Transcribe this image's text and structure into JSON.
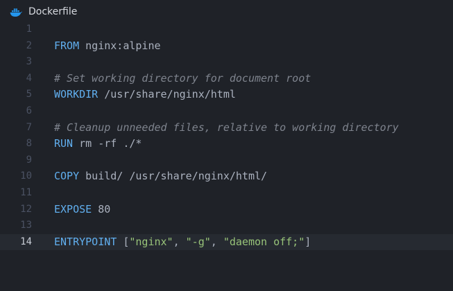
{
  "tab": {
    "title": "Dockerfile",
    "icon": "docker-whale-icon",
    "icon_color": "#2496ed"
  },
  "colors": {
    "background": "#1f2228",
    "keyword": "#61afef",
    "comment": "#7f848e",
    "string": "#98c379",
    "text": "#abb2bf",
    "line_number": "#4b5263",
    "active_line_number": "#c8cdd6"
  },
  "editor": {
    "active_line": 14,
    "lines": [
      {
        "number": "1",
        "keyword": "",
        "comment": "",
        "text": ""
      },
      {
        "number": "2",
        "keyword": "FROM",
        "comment": "",
        "text": " nginx:alpine"
      },
      {
        "number": "3",
        "keyword": "",
        "comment": "",
        "text": ""
      },
      {
        "number": "4",
        "keyword": "",
        "comment": "# Set working directory for document root",
        "text": ""
      },
      {
        "number": "5",
        "keyword": "WORKDIR",
        "comment": "",
        "text": " /usr/share/nginx/html"
      },
      {
        "number": "6",
        "keyword": "",
        "comment": "",
        "text": ""
      },
      {
        "number": "7",
        "keyword": "",
        "comment": "# Cleanup unneeded files, relative to working directory",
        "text": ""
      },
      {
        "number": "8",
        "keyword": "RUN",
        "comment": "",
        "text": " rm -rf ./*"
      },
      {
        "number": "9",
        "keyword": "",
        "comment": "",
        "text": ""
      },
      {
        "number": "10",
        "keyword": "COPY",
        "comment": "",
        "text": " build/ /usr/share/nginx/html/"
      },
      {
        "number": "11",
        "keyword": "",
        "comment": "",
        "text": ""
      },
      {
        "number": "12",
        "keyword": "EXPOSE",
        "comment": "",
        "text": " 80"
      },
      {
        "number": "13",
        "keyword": "",
        "comment": "",
        "text": ""
      },
      {
        "number": "14",
        "keyword": "ENTRYPOINT",
        "comment": "",
        "text": "",
        "entrypoint": {
          "open": " [",
          "arg1": "\"nginx\"",
          "sep1": ", ",
          "arg2": "\"-g\"",
          "sep2": ", ",
          "arg3": "\"daemon off;\"",
          "close": "]"
        }
      }
    ]
  }
}
